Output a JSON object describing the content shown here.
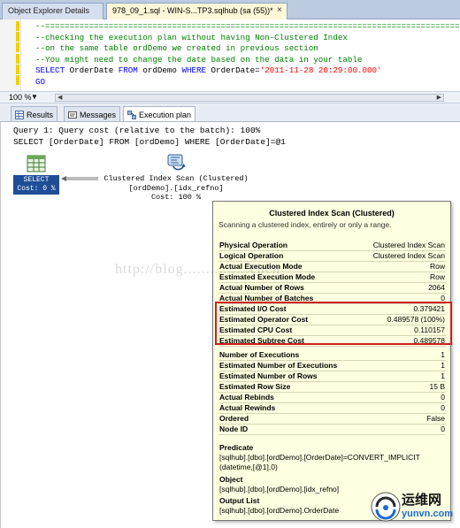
{
  "tabs": {
    "object_explorer": "Object Explorer Details",
    "sql_doc": "978_09_1.sql - WIN-S...TP3.sqlhub (sa (55))*",
    "close": "×"
  },
  "editor": {
    "lines": [
      {
        "type": "comment",
        "text": "--======================================================================================"
      },
      {
        "type": "comment",
        "text": "--checking the execution plan without having Non-Clustered Index"
      },
      {
        "type": "comment",
        "text": "--on the same table ordDemo we created in previous section"
      },
      {
        "type": "comment",
        "text": "--You might need to change the date based on the data in your table"
      }
    ],
    "select_line": {
      "kw1": "SELECT",
      "col": "OrderDate",
      "kw2": "FROM",
      "tbl": "ordDemo",
      "kw3": "WHERE",
      "col2": "OrderDate",
      "op": "=",
      "val": "'2011-11-28 20:29:00.000'"
    },
    "go": "GO"
  },
  "zoom": {
    "value": "100 %",
    "arrow": "▼"
  },
  "result_tabs": {
    "results": "Results",
    "messages": "Messages",
    "execution_plan": "Execution plan"
  },
  "plan": {
    "query_line1": "Query 1: Query cost (relative to the batch): 100%",
    "query_line2": "SELECT [OrderDate] FROM [ordDemo] WHERE [OrderDate]=@1",
    "select_node": {
      "label": "SELECT",
      "cost": "Cost: 0 %"
    },
    "scan_node": {
      "line1": "Clustered Index Scan (Clustered)",
      "line2": "[ordDemo].[idx_refno]",
      "line3": "Cost: 100 %"
    }
  },
  "tooltip": {
    "title": "Clustered Index Scan (Clustered)",
    "description": "Scanning a clustered index, entirely or only a range.",
    "rows_a": [
      {
        "k": "Physical Operation",
        "v": "Clustered Index Scan"
      },
      {
        "k": "Logical Operation",
        "v": "Clustered Index Scan"
      },
      {
        "k": "Actual Execution Mode",
        "v": "Row"
      },
      {
        "k": "Estimated Execution Mode",
        "v": "Row"
      },
      {
        "k": "Actual Number of Rows",
        "v": "2064"
      },
      {
        "k": "Actual Number of Batches",
        "v": "0"
      },
      {
        "k": "Estimated I/O Cost",
        "v": "0.379421"
      },
      {
        "k": "Estimated Operator Cost",
        "v": "0.489578 (100%)"
      },
      {
        "k": "Estimated CPU Cost",
        "v": "0.110157"
      },
      {
        "k": "Estimated Subtree Cost",
        "v": "0.489578"
      }
    ],
    "rows_b": [
      {
        "k": "Number of Executions",
        "v": "1"
      },
      {
        "k": "Estimated Number of Executions",
        "v": "1"
      },
      {
        "k": "Estimated Number of Rows",
        "v": "1"
      },
      {
        "k": "Estimated Row Size",
        "v": "15 B"
      },
      {
        "k": "Actual Rebinds",
        "v": "0"
      },
      {
        "k": "Actual Rewinds",
        "v": "0"
      },
      {
        "k": "Ordered",
        "v": "False"
      },
      {
        "k": "Node ID",
        "v": "0"
      }
    ],
    "predicate_h": "Predicate",
    "predicate_1": "[sqlhub].[dbo].[ordDemo].[OrderDate]=CONVERT_IMPLICIT",
    "predicate_2": "(datetime,[@1],0)",
    "object_h": "Object",
    "object_v": "[sqlhub].[dbo].[ordDemo].[idx_refno]",
    "output_h": "Output List",
    "output_v": "[sqlhub].[dbo].[ordDemo].OrderDate"
  },
  "watermark": "http://blog...............chen",
  "logo": {
    "cn": "运维网",
    "en": "yunvn.com"
  },
  "colors": {
    "highlight_box": "#cc1f1f",
    "select_bg": "#1f4e97",
    "tooltip_bg": "#ffffe1"
  }
}
